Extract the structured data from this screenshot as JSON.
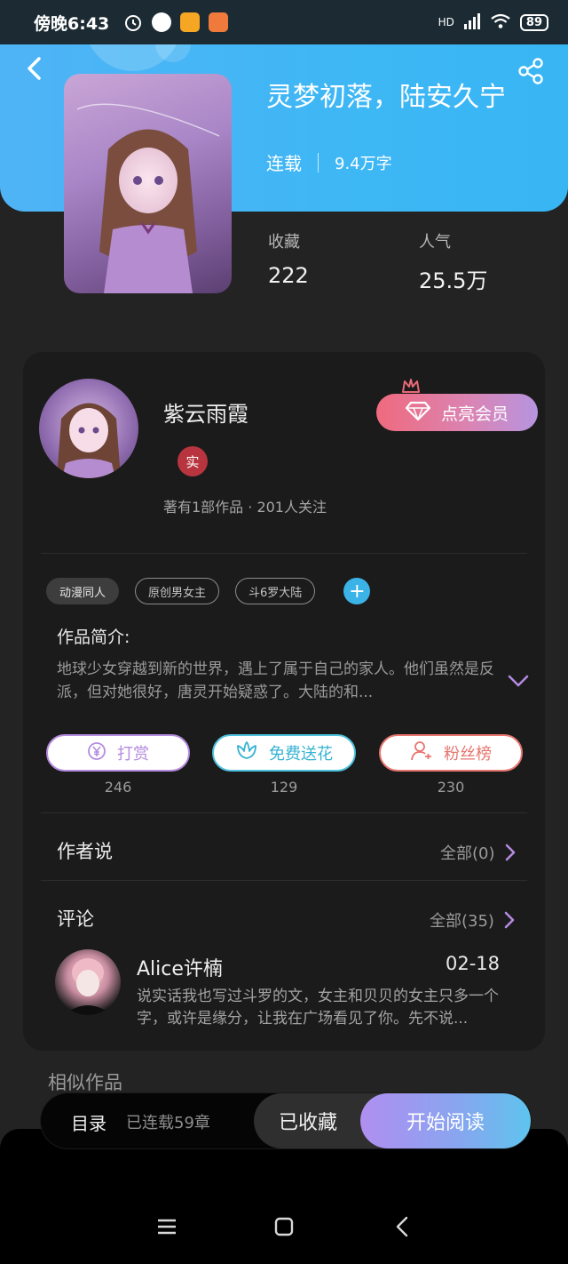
{
  "status_bar": {
    "time": "傍晚6:43",
    "network": "HD",
    "battery": "89"
  },
  "book": {
    "title": "灵梦初落，陆安久宁",
    "status": "连载",
    "word_count": "9.4万字",
    "stats": [
      {
        "label": "收藏",
        "value": "222"
      },
      {
        "label": "人气",
        "value": "25.5万"
      }
    ]
  },
  "author": {
    "name": "紫云雨霞",
    "badge": "实",
    "info": "著有1部作品 · 201人关注",
    "vip_button": "点亮会员"
  },
  "tags": [
    "动漫同人",
    "原创男女主",
    "斗6罗大陆"
  ],
  "intro": {
    "heading": "作品简介:",
    "text": "地球少女穿越到新的世界，遇上了属于自己的家人。他们虽然是反派，但对她很好，唐灵开始疑惑了。大陆的和..."
  },
  "actions": [
    {
      "label": "打赏",
      "count": "246",
      "color": "#b58be0"
    },
    {
      "label": "免费送花",
      "count": "129",
      "color": "#4cc1dc"
    },
    {
      "label": "粉丝榜",
      "count": "230",
      "color": "#e7756e"
    }
  ],
  "author_says": {
    "title": "作者说",
    "more": "全部(0)"
  },
  "comments": {
    "title": "评论",
    "more": "全部(35)",
    "items": [
      {
        "name": "Alice许楠",
        "date": "02-18",
        "text": "说实话我也写过斗罗的文，女主和贝贝的女主只多一个字，或许是缘分，让我在广场看见了你。先不说..."
      }
    ]
  },
  "similar": "相似作品",
  "bottom_bar": {
    "toc": "目录",
    "chapters": "已连载59章",
    "collected": "已收藏",
    "read": "开始阅读"
  },
  "colors": {
    "header": "#3fb7f5",
    "vip_gradient_start": "#f06a7d",
    "vip_gradient_end": "#b694e0",
    "read_gradient_start": "#b08ff1",
    "read_gradient_end": "#5ec4ee"
  }
}
